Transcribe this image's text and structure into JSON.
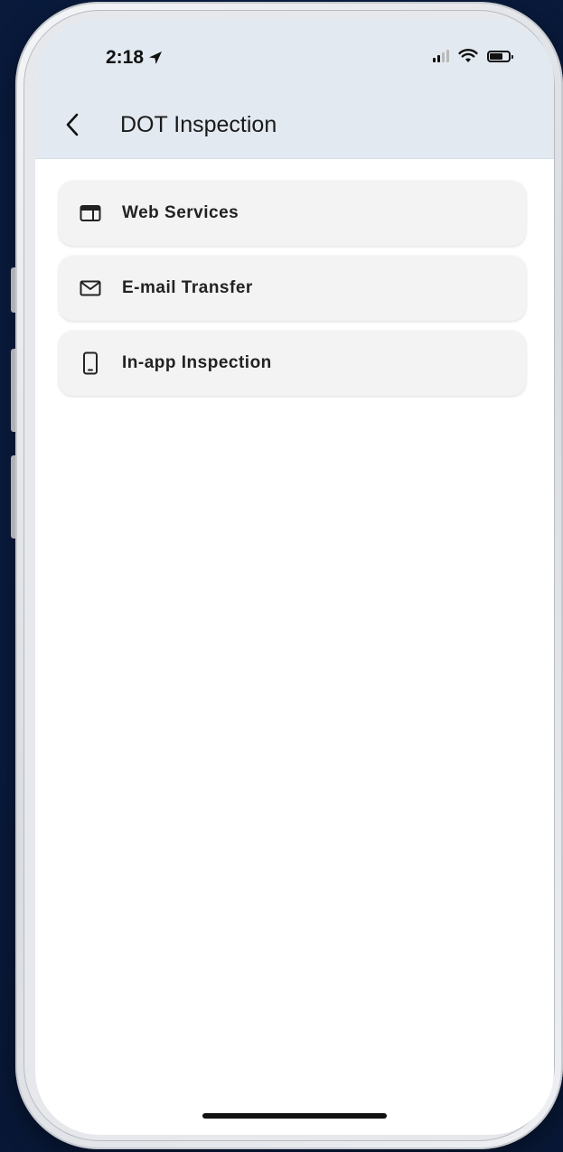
{
  "status_bar": {
    "time": "2:18",
    "location_icon": "location-arrow-icon",
    "signal_icon": "cellular-signal-icon",
    "wifi_icon": "wifi-icon",
    "battery_icon": "battery-icon"
  },
  "header": {
    "back_icon": "chevron-left-icon",
    "title": "DOT Inspection"
  },
  "menu": {
    "items": [
      {
        "label": "Web Services",
        "icon": "web-browser-icon"
      },
      {
        "label": "E-mail Transfer",
        "icon": "envelope-icon"
      },
      {
        "label": "In-app Inspection",
        "icon": "smartphone-icon"
      }
    ]
  },
  "colors": {
    "background": "#0b1f45",
    "header_bg": "#e2e9f1",
    "item_bg": "#f3f3f3",
    "text": "#222222"
  }
}
